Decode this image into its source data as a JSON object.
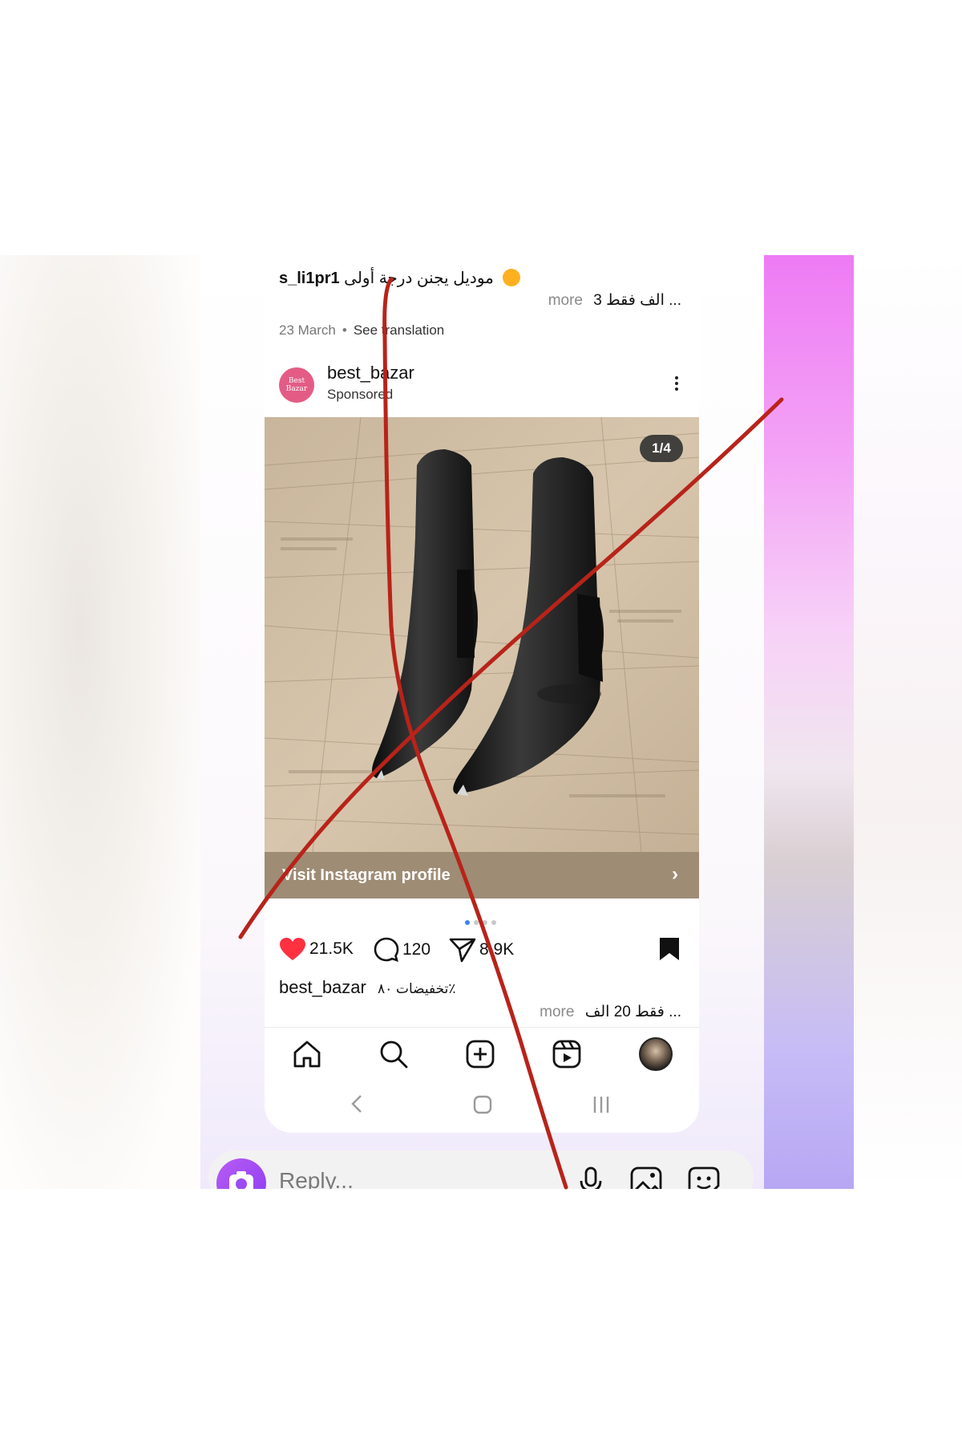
{
  "previous_post": {
    "username": "s_li1pr1",
    "caption_arabic": "موديل يجنن درجة أولى",
    "more_line_text": "3 الف فقط ...",
    "more_label": "more",
    "date": "23 March",
    "see_translation": "See translation"
  },
  "post": {
    "account_name": "best_bazar",
    "avatar_text": "Best Bazar",
    "sponsored_label": "Sponsored",
    "image_counter": "1/4",
    "visit_profile_label": "Visit Instagram profile",
    "likes": "21.5K",
    "comments": "120",
    "shares": "8.9K",
    "caption_user": "best_bazar",
    "caption_arabic": "تخفيضات ٨٠٪",
    "caption_more_text": "فقط 20 الف ...",
    "more_label": "more"
  },
  "carousel": {
    "total": 4,
    "current": 1
  },
  "bottom_nav": {
    "items": [
      "home-icon",
      "search-icon",
      "create-icon",
      "reels-icon",
      "profile-avatar"
    ]
  },
  "reply_bar": {
    "placeholder": "Reply..."
  },
  "colors": {
    "like_red": "#ff3040",
    "visit_bar": "#9e8c75",
    "annotation_red": "#b8231a",
    "accent_purple": "#9b4cf3"
  }
}
